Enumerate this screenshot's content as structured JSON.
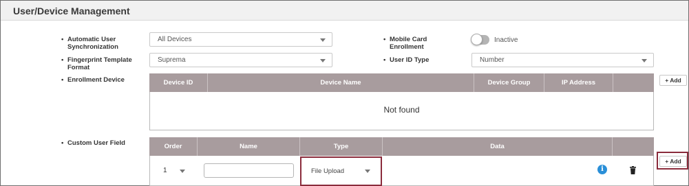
{
  "header": {
    "title": "User/Device Management"
  },
  "settings": {
    "auto_sync": {
      "label": "Automatic User Synchronization",
      "value": "All Devices"
    },
    "fingerprint_format": {
      "label": "Fingerprint Template Format",
      "value": "Suprema"
    },
    "enrollment_device": {
      "label": "Enrollment Device"
    },
    "custom_user_field": {
      "label": "Custom User Field"
    },
    "mobile_card": {
      "label": "Mobile Card Enrollment",
      "state": "Inactive"
    },
    "user_id_type": {
      "label": "User ID Type",
      "value": "Number"
    }
  },
  "enrollment_table": {
    "columns": [
      "Device ID",
      "Device Name",
      "Device Group",
      "IP Address"
    ],
    "empty_text": "Not found",
    "add_label": "+ Add"
  },
  "custom_field_table": {
    "columns": [
      "Order",
      "Name",
      "Type",
      "Data"
    ],
    "add_label": "+ Add",
    "rows": [
      {
        "order": "1",
        "name": "",
        "type": "File Upload"
      }
    ]
  },
  "colors": {
    "table_header": "#a89c9e",
    "highlight": "#8a2b3b",
    "info": "#2a8fd8"
  },
  "icons": [
    "chevron-down-icon",
    "info-icon",
    "trash-icon"
  ]
}
